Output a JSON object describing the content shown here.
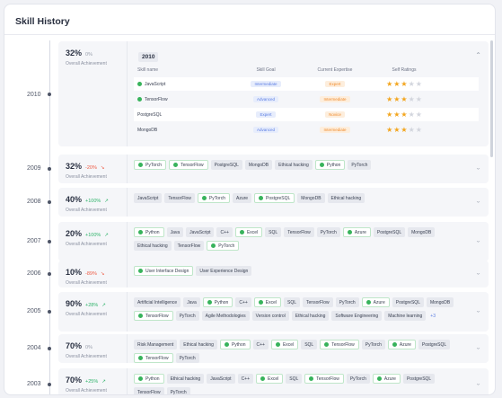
{
  "card": {
    "title": "Skill History"
  },
  "expanded": {
    "year": "2010",
    "percent": "32%",
    "delta": "0%",
    "achievement_label": "Overall Achievement",
    "badge": "2010",
    "headers": [
      "Skill name",
      "Skill Goal",
      "Current Expertise",
      "Self Ratings"
    ],
    "rows": [
      {
        "name": "JavaScript",
        "goal": "Intermediate",
        "current": "Expert",
        "rating": 3,
        "green": true
      },
      {
        "name": "TensorFlow",
        "goal": "Advanced",
        "current": "Intermediate",
        "rating": 3,
        "green": true
      },
      {
        "name": "PostgreSQL",
        "goal": "Expert",
        "current": "Novice",
        "rating": 3,
        "green": false
      },
      {
        "name": "MongoDB",
        "goal": "Advanced",
        "current": "Intermediate",
        "rating": 3,
        "green": false
      }
    ]
  },
  "years": [
    {
      "year": "2009",
      "percent": "32%",
      "delta": "-20%",
      "trend": "neg",
      "label": "Overall Achievement",
      "tags": [
        {
          "t": "PyTorch",
          "g": true
        },
        {
          "t": "TensorFlow",
          "g": true
        },
        {
          "t": "PostgreSQL",
          "g": false
        },
        {
          "t": "MongoDB",
          "g": false
        },
        {
          "t": "Ethical hacking",
          "g": false
        },
        {
          "t": "Python",
          "g": true
        },
        {
          "t": "PyTorch",
          "g": false
        }
      ]
    },
    {
      "year": "2008",
      "percent": "40%",
      "delta": "+100%",
      "trend": "pos",
      "label": "Overall Achievement",
      "tags": [
        {
          "t": "JavaScript",
          "g": false
        },
        {
          "t": "TensorFlow",
          "g": false
        },
        {
          "t": "PyTorch",
          "g": true
        },
        {
          "t": "Azure",
          "g": false
        },
        {
          "t": "PostgreSQL",
          "g": true
        },
        {
          "t": "MongoDB",
          "g": false
        },
        {
          "t": "Ethical hacking",
          "g": false
        }
      ]
    },
    {
      "year": "2007",
      "percent": "20%",
      "delta": "+100%",
      "trend": "pos",
      "label": "Overall Achievement",
      "tags": [
        {
          "t": "Python",
          "g": true
        },
        {
          "t": "Java",
          "g": false
        },
        {
          "t": "JavaScript",
          "g": false
        },
        {
          "t": "C++",
          "g": false
        },
        {
          "t": "Excel",
          "g": true
        },
        {
          "t": "SQL",
          "g": false
        },
        {
          "t": "TensorFlow",
          "g": false
        },
        {
          "t": "PyTorch",
          "g": false
        },
        {
          "t": "Azure",
          "g": true
        },
        {
          "t": "PostgreSQL",
          "g": false
        },
        {
          "t": "MongoDB",
          "g": false
        },
        {
          "t": "Ethical hacking",
          "g": false
        },
        {
          "t": "TensorFlow",
          "g": false
        },
        {
          "t": "PyTorch",
          "g": true
        }
      ]
    },
    {
      "year": "2006",
      "percent": "10%",
      "delta": "-89%",
      "trend": "neg",
      "label": "Overall Achievement",
      "tags": [
        {
          "t": "User Interface Design",
          "g": true
        },
        {
          "t": "User Experience Design",
          "g": false
        }
      ]
    },
    {
      "year": "2005",
      "percent": "90%",
      "delta": "+28%",
      "trend": "pos",
      "label": "Overall Achievement",
      "tags": [
        {
          "t": "Artificial Intelligence",
          "g": false
        },
        {
          "t": "Java",
          "g": false
        },
        {
          "t": "Python",
          "g": true
        },
        {
          "t": "C++",
          "g": false
        },
        {
          "t": "Excel",
          "g": true
        },
        {
          "t": "SQL",
          "g": false
        },
        {
          "t": "TensorFlow",
          "g": false
        },
        {
          "t": "PyTorch",
          "g": false
        },
        {
          "t": "Azure",
          "g": true
        },
        {
          "t": "PostgreSQL",
          "g": false
        },
        {
          "t": "MongoDB",
          "g": false
        },
        {
          "t": "TensorFlow",
          "g": true
        },
        {
          "t": "PyTorch",
          "g": false
        },
        {
          "t": "Agile Methodologies",
          "g": false
        },
        {
          "t": "Version control",
          "g": false
        },
        {
          "t": "Ethical hacking",
          "g": false
        },
        {
          "t": "Software Engineering",
          "g": false
        },
        {
          "t": "Machine learning",
          "g": false
        }
      ],
      "more": "+3"
    },
    {
      "year": "2004",
      "percent": "70%",
      "delta": "0%",
      "trend": "zero",
      "label": "Overall Achievement",
      "tags": [
        {
          "t": "Risk Management",
          "g": false
        },
        {
          "t": "Ethical hacking",
          "g": false
        },
        {
          "t": "Python",
          "g": true
        },
        {
          "t": "C++",
          "g": false
        },
        {
          "t": "Excel",
          "g": true
        },
        {
          "t": "SQL",
          "g": false
        },
        {
          "t": "TensorFlow",
          "g": true
        },
        {
          "t": "PyTorch",
          "g": false
        },
        {
          "t": "Azure",
          "g": true
        },
        {
          "t": "PostgreSQL",
          "g": false
        },
        {
          "t": "TensorFlow",
          "g": true
        },
        {
          "t": "PyTorch",
          "g": false
        }
      ]
    },
    {
      "year": "2003",
      "percent": "70%",
      "delta": "+25%",
      "trend": "pos",
      "label": "Overall Achievement",
      "tags": [
        {
          "t": "Python",
          "g": true
        },
        {
          "t": "Ethical hacking",
          "g": false
        },
        {
          "t": "JavaScript",
          "g": false
        },
        {
          "t": "C++",
          "g": false
        },
        {
          "t": "Excel",
          "g": true
        },
        {
          "t": "SQL",
          "g": false
        },
        {
          "t": "TensorFlow",
          "g": true
        },
        {
          "t": "PyTorch",
          "g": false
        },
        {
          "t": "Azure",
          "g": true
        },
        {
          "t": "PostgreSQL",
          "g": false
        },
        {
          "t": "TensorFlow",
          "g": false
        },
        {
          "t": "PyTorch",
          "g": false
        }
      ]
    }
  ],
  "colors": {
    "accent_green": "#37b35b",
    "star": "#f3a51d",
    "neg": "#ee5b44",
    "pos": "#2fb36a"
  },
  "icons": {
    "collapse": "chevron-up-icon",
    "expand": "chevron-down-icon",
    "skill": "check-circle-icon",
    "rating": "star-icon",
    "trend": "trend-arrow-icon"
  }
}
